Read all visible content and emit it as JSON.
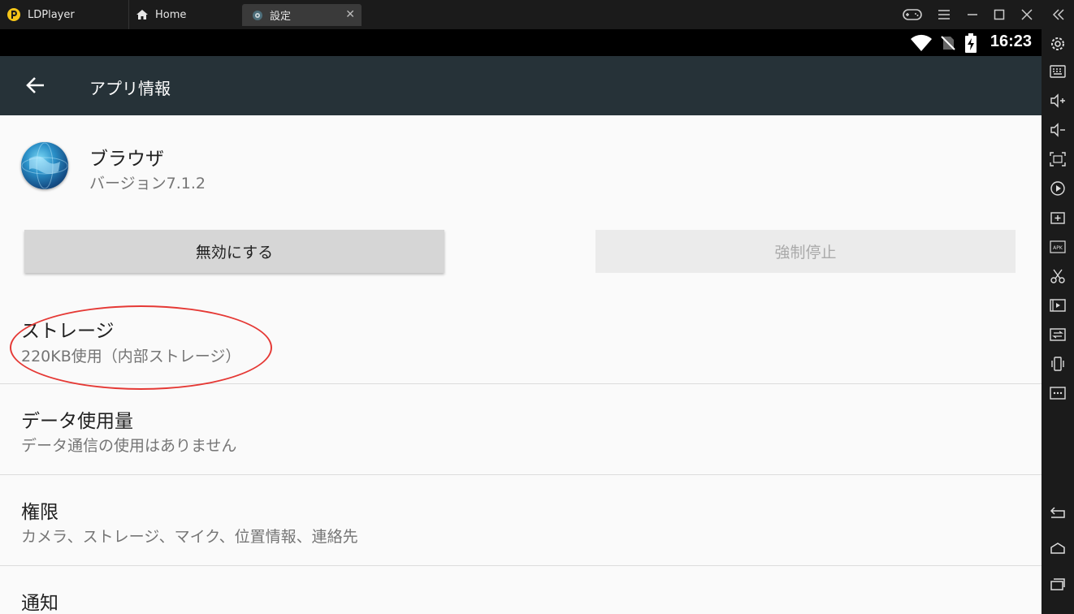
{
  "window": {
    "tabs": [
      {
        "label": "LDPlayer"
      },
      {
        "label": "Home"
      },
      {
        "label": "設定"
      }
    ]
  },
  "status": {
    "time": "16:23"
  },
  "appbar": {
    "title": "アプリ情報"
  },
  "app": {
    "name": "ブラウザ",
    "version": "バージョン7.1.2"
  },
  "buttons": {
    "disable": "無効にする",
    "force_stop": "強制停止"
  },
  "rows": [
    {
      "title": "ストレージ",
      "subtitle": "220KB使用（内部ストレージ）"
    },
    {
      "title": "データ使用量",
      "subtitle": "データ通信の使用はありません"
    },
    {
      "title": "権限",
      "subtitle": "カメラ、ストレージ、マイク、位置情報、連絡先"
    },
    {
      "title": "通知",
      "subtitle": ""
    }
  ],
  "colors": {
    "appbar": "#263238",
    "annotation": "#e53935",
    "logo": "#f5c518"
  }
}
